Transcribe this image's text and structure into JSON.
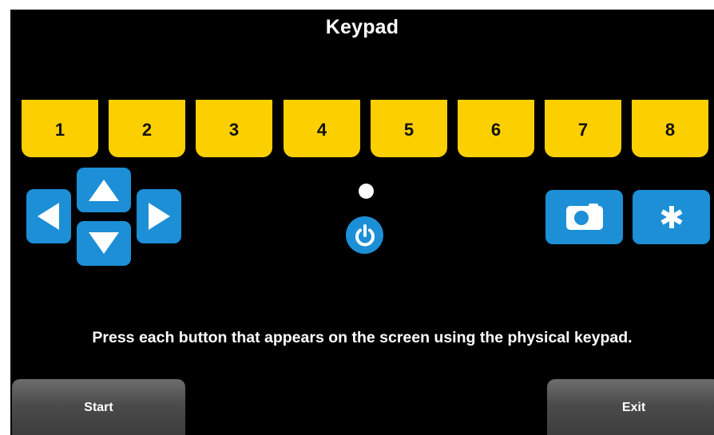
{
  "title": "Keypad",
  "function_keys": [
    "1",
    "2",
    "3",
    "4",
    "5",
    "6",
    "7",
    "8"
  ],
  "arrow_icons": [
    "arrow-left-icon",
    "arrow-up-icon",
    "arrow-down-icon",
    "arrow-right-icon"
  ],
  "status_icons": [
    "indicator-light-icon",
    "power-icon"
  ],
  "action_icons": [
    "camera-icon",
    "asterisk-icon"
  ],
  "instruction": "Press each button that appears on the screen using the physical keypad.",
  "footer": {
    "start_label": "Start",
    "exit_label": "Exit"
  },
  "colors": {
    "screen_background": "#000000",
    "function_key": "#fccf00",
    "action_blue": "#1c8fd6",
    "soft_button": "#4b4b4b",
    "text": "#ffffff"
  }
}
